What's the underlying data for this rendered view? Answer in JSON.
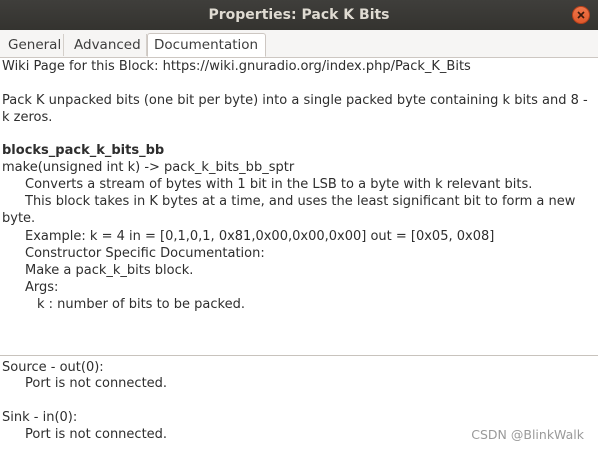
{
  "window": {
    "title": "Properties: Pack K Bits"
  },
  "tabs": [
    {
      "label": "General"
    },
    {
      "label": "Advanced"
    },
    {
      "label": "Documentation"
    }
  ],
  "documentation": {
    "wiki_line": "Wiki Page for this Block: https://wiki.gnuradio.org/index.php/Pack_K_Bits",
    "summary": "Pack K unpacked bits (one bit per byte) into a single packed byte containing k bits and 8 - k zeros.",
    "block_name": "blocks_pack_k_bits_bb",
    "signature": "make(unsigned int k) -> pack_k_bits_bb_sptr",
    "desc1": "Converts a stream of bytes with 1 bit in the LSB to a byte with k relevant bits.",
    "desc2": "This block takes in K bytes at a time, and uses the least significant bit to form a new byte.",
    "example": "Example: k = 4 in = [0,1,0,1, 0x81,0x00,0x00,0x00] out = [0x05, 0x08]",
    "ctor_doc": "Constructor Specific Documentation:",
    "make_desc": "Make a pack_k_bits block.",
    "args_label": "Args:",
    "arg_k": "k : number of bits to be packed."
  },
  "ports": {
    "source_label": "Source - out(0):",
    "source_status": "Port is not connected.",
    "sink_label": "Sink - in(0):",
    "sink_status": "Port is not connected."
  },
  "watermark": "CSDN @BlinkWalk"
}
